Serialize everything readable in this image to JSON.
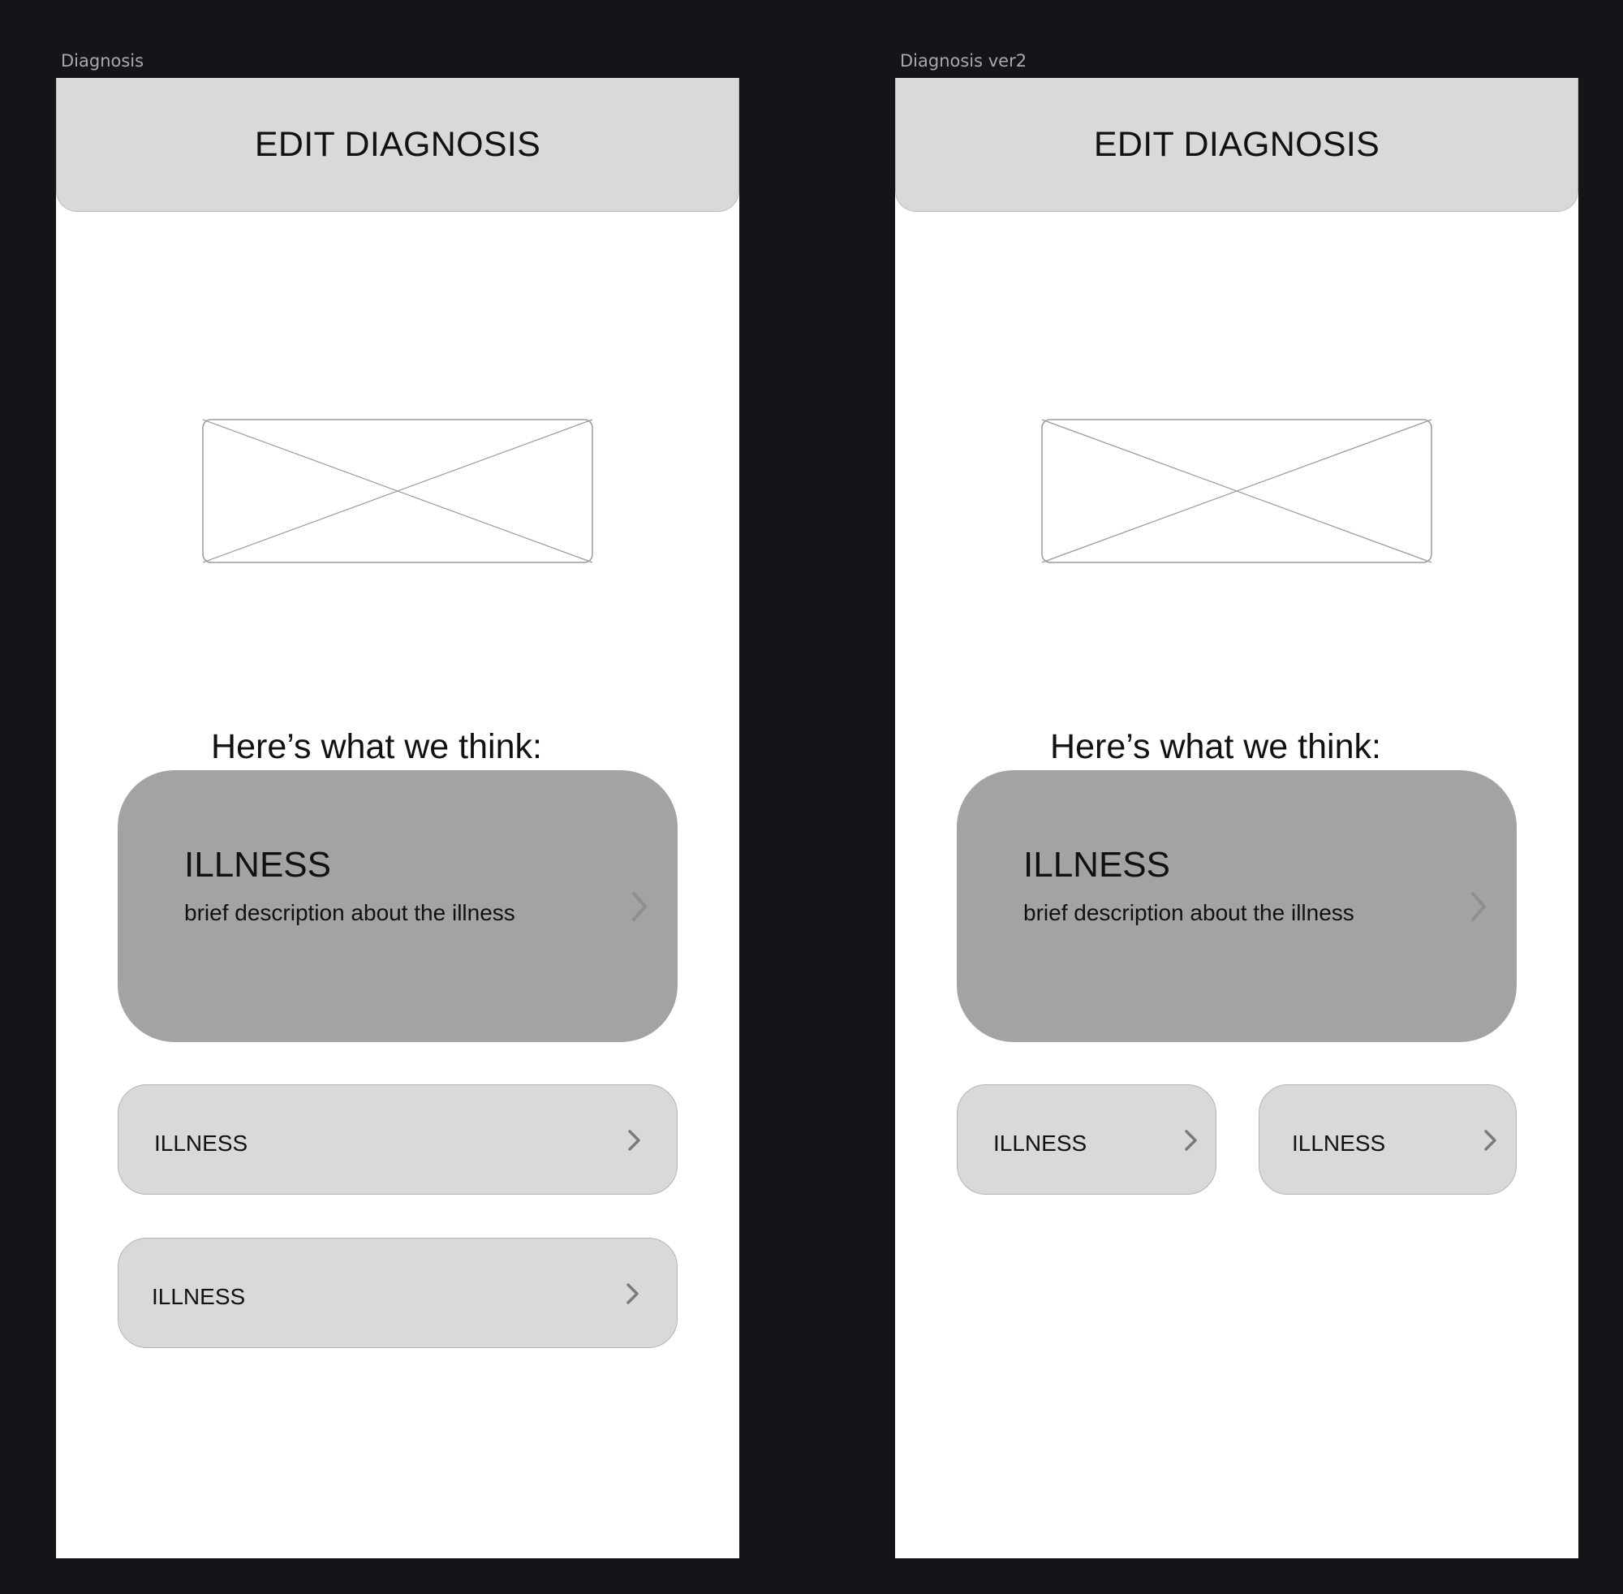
{
  "frames": [
    {
      "label": "Diagnosis",
      "header_title": "EDIT DIAGNOSIS",
      "subtitle": "Here’s what we think:",
      "main_card": {
        "title": "ILLNESS",
        "description": "brief description about the illness"
      },
      "options": [
        {
          "label": "ILLNESS"
        },
        {
          "label": "ILLNESS"
        }
      ]
    },
    {
      "label": "Diagnosis ver2",
      "header_title": "EDIT DIAGNOSIS",
      "subtitle": "Here’s what we think:",
      "main_card": {
        "title": "ILLNESS",
        "description": "brief description about the illness"
      },
      "options": [
        {
          "label": "ILLNESS"
        },
        {
          "label": "ILLNESS"
        }
      ]
    }
  ],
  "icons": {
    "option_arrow": "chevron-right-icon",
    "image_placeholder": "image-placeholder-icon"
  },
  "colors": {
    "canvas": "#141518",
    "frame": "#ffffff",
    "header": "#d9d9d9",
    "main_card": "#a3a3a3",
    "option_pill": "#d9d9d9",
    "chevron": "#7a7a7a"
  }
}
